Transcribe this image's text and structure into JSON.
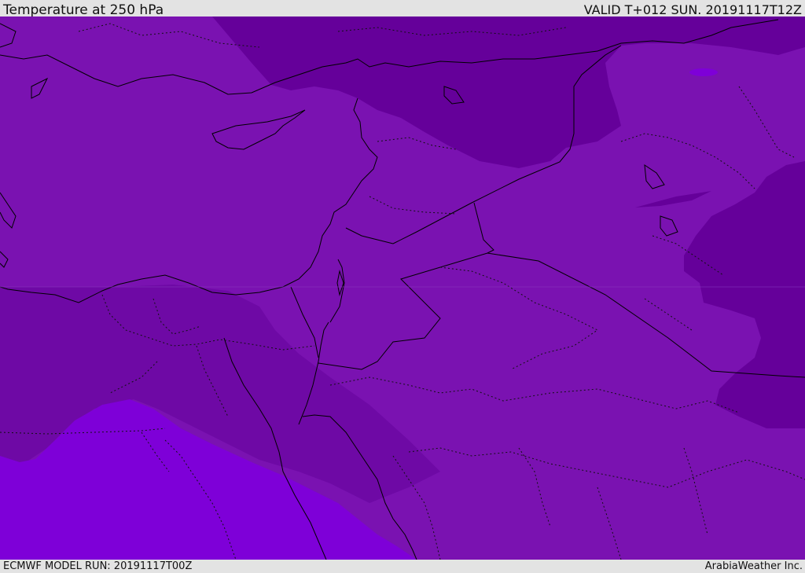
{
  "header": {
    "title": "Temperature at 250 hPa",
    "valid": "VALID T+012 SUN. 20191117T12Z"
  },
  "footer": {
    "model_run": "ECMWF MODEL RUN: 20191117T00Z",
    "credit": "ArabiaWeather Inc."
  },
  "map": {
    "field_colors": {
      "base": "#7a12b1",
      "cold": "#65009a",
      "colder": "#6e09a5",
      "warm": "#7e00d8",
      "outline": "#000000"
    }
  }
}
